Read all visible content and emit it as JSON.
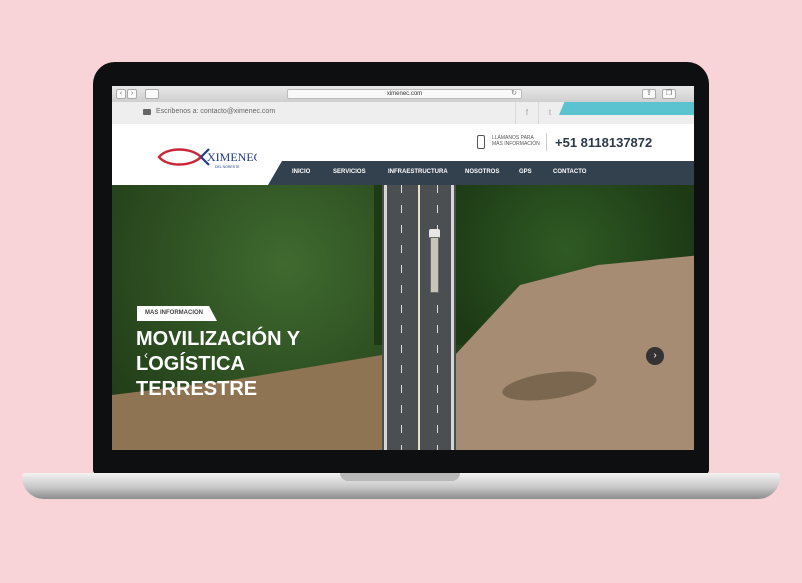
{
  "browser": {
    "url": "ximenec.com"
  },
  "topbar": {
    "email_text": "Escribenos a: contacto@ximenec.com",
    "social": [
      "f",
      "t"
    ]
  },
  "header": {
    "logo_text": "XIMENEC",
    "logo_sub": "DEL NORESTE",
    "call_label_1": "LLÁMANOS PARA",
    "call_label_2": "MÁS INFORMACIÓN",
    "phone": "+51 8118137872"
  },
  "nav": {
    "items": [
      "INICIO",
      "SERVICIOS",
      "INFRAESTRUCTURA",
      "NOSOTROS",
      "GPS",
      "CONTACTO"
    ]
  },
  "hero": {
    "button_label": "MAS INFORMACION",
    "title_line1": "MOVILIZACIÓN Y",
    "title_line2": "LOGÍSTICA",
    "title_line3": "TERRESTRE",
    "prev": "‹",
    "next": "›"
  },
  "colors": {
    "background": "#f8d3d7",
    "nav": "#33414e",
    "accent": "#5bc2cf",
    "logo_red": "#c8283a",
    "logo_blue": "#1f3a8a"
  }
}
